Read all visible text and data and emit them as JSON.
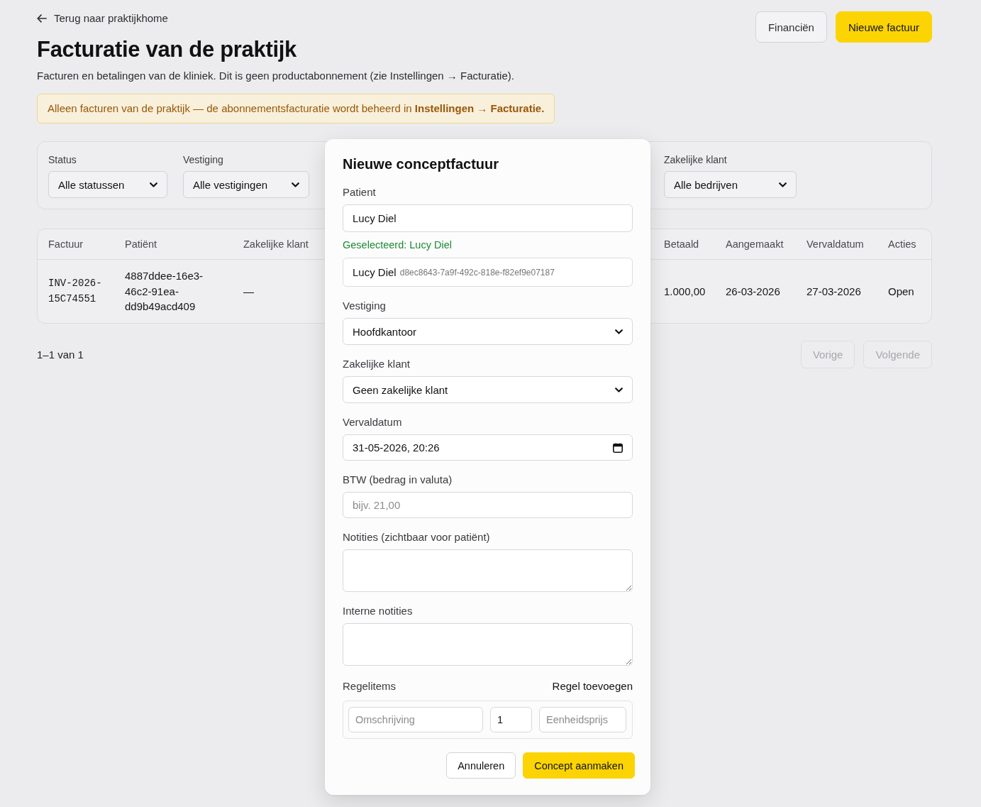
{
  "back_link": {
    "label": "Terug naar praktijkhome"
  },
  "header_actions": [
    {
      "label": "Financiën",
      "kind": "secondary"
    },
    {
      "label": "Nieuwe factuur",
      "kind": "primary"
    }
  ],
  "title": "Facturatie van de praktijk",
  "subtitle": "Facturen en betalingen van de kliniek. Dit is geen productabonnement (zie Instellingen → Facturatie).",
  "notice": "Alleen facturen van de praktijk — de abonnementsfacturatie wordt beheerd in **Instellingen → Facturatie.**",
  "filters": [
    {
      "label": "Status",
      "value": "Alle statussen"
    },
    {
      "label": "Vestiging",
      "value": "Alle vestigingen"
    },
    {
      "label": "Zakelijke klant",
      "value": "Alle bedrijven"
    }
  ],
  "table": {
    "columns": [
      {
        "label": "Factuur",
        "kind": "code"
      },
      {
        "label": "Patiënt",
        "kind": "id"
      },
      {
        "label": "Zakelijke klant",
        "kind": "text"
      },
      {
        "label": "Betaald",
        "kind": "text"
      },
      {
        "label": "Aangemaakt",
        "kind": "text"
      },
      {
        "label": "Vervaldatum",
        "kind": "text"
      },
      {
        "label": "Acties",
        "kind": "text"
      }
    ],
    "rows": [
      {
        "cells": [
          "INV-2026-15C74551",
          "4887ddee-16e3-46c2-91ea-dd9b49acd409",
          "—",
          "1.000,00",
          "26-03-2026",
          "27-03-2026",
          "Open"
        ]
      }
    ]
  },
  "pagination": {
    "range": "1–1 van 1",
    "buttons": [
      {
        "label": "Vorige",
        "disabled": true
      },
      {
        "label": "Volgende",
        "disabled": true
      }
    ]
  },
  "dialog": {
    "title": "Nieuwe conceptfactuur",
    "fields": [
      {
        "kind": "search",
        "label": "Patient",
        "value": "Lucy Diel",
        "note": "Geselecteerd: Lucy Diel",
        "option": {
          "name": "Lucy Diel",
          "id": "d8ec8643-7a9f-492c-818e-f82ef9e07187"
        }
      },
      {
        "kind": "select",
        "label": "Vestiging",
        "value": "Hoofdkantoor"
      },
      {
        "kind": "select",
        "label": "Zakelijke klant",
        "value": "Geen zakelijke klant"
      },
      {
        "kind": "datetime",
        "label": "Vervaldatum",
        "value": "31-05-2026, 20:26"
      },
      {
        "kind": "text",
        "label": "BTW (bedrag in valuta)",
        "placeholder": "bijv. 21,00"
      },
      {
        "kind": "textarea",
        "label": "Notities (zichtbaar voor patiënt)"
      },
      {
        "kind": "textarea",
        "label": "Interne notities"
      }
    ],
    "line_items": {
      "label": "Regelitems",
      "add_label": "Regel toevoegen",
      "rows": [
        {
          "description": {
            "placeholder": "Omschrijving"
          },
          "quantity": {
            "value": "1"
          },
          "unit_price": {
            "placeholder": "Eenheidsprijs"
          }
        }
      ]
    },
    "actions": [
      {
        "label": "Annuleren",
        "kind": "secondary"
      },
      {
        "label": "Concept aanmaken",
        "kind": "primary"
      }
    ]
  }
}
